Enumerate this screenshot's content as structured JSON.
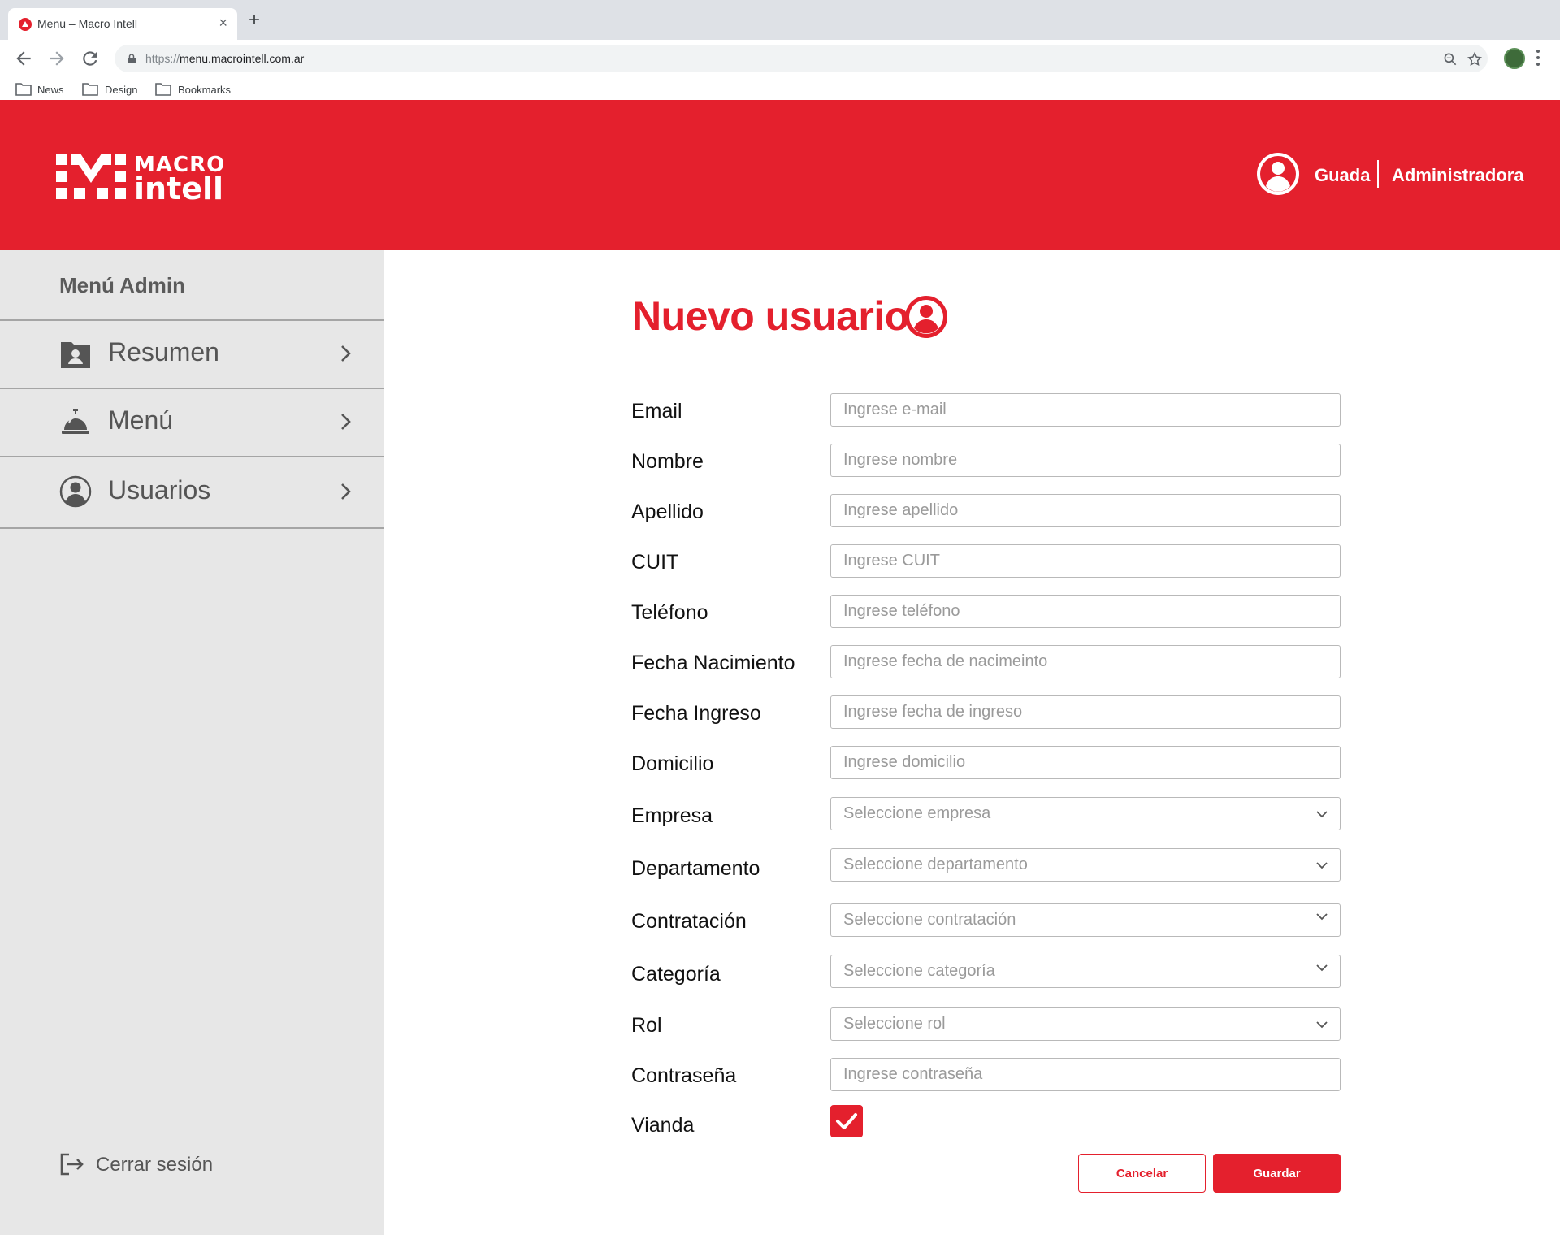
{
  "browser": {
    "tab_title": "Menu – Macro Intell",
    "url_scheme": "https://",
    "url_host": "menu.macrointell.com.ar",
    "bookmarks": [
      "News",
      "Design",
      "Bookmarks"
    ]
  },
  "header": {
    "logo_line1": "MACRO",
    "logo_line2": "intell",
    "user_name": "Guada",
    "user_role": "Administradora",
    "brand_color": "#e4202d"
  },
  "sidebar": {
    "title": "Menú Admin",
    "items": [
      {
        "label": "Resumen",
        "icon": "folder-user-icon"
      },
      {
        "label": "Menú",
        "icon": "service-bell-icon"
      },
      {
        "label": "Usuarios",
        "icon": "user-circle-icon"
      }
    ],
    "logout_label": "Cerrar sesión"
  },
  "form": {
    "title": "Nuevo usuario",
    "fields": [
      {
        "label": "Email",
        "placeholder": "Ingrese e-mail",
        "type": "text"
      },
      {
        "label": "Nombre",
        "placeholder": "Ingrese nombre",
        "type": "text"
      },
      {
        "label": "Apellido",
        "placeholder": "Ingrese apellido",
        "type": "text"
      },
      {
        "label": "CUIT",
        "placeholder": "Ingrese CUIT",
        "type": "text"
      },
      {
        "label": "Teléfono",
        "placeholder": "Ingrese teléfono",
        "type": "text"
      },
      {
        "label": "Fecha Nacimiento",
        "placeholder": "Ingrese fecha de nacimeinto",
        "type": "text"
      },
      {
        "label": "Fecha Ingreso",
        "placeholder": "Ingrese fecha de ingreso",
        "type": "text"
      },
      {
        "label": "Domicilio",
        "placeholder": "Ingrese domicilio",
        "type": "text"
      },
      {
        "label": "Empresa",
        "placeholder": "Seleccione empresa",
        "type": "select"
      },
      {
        "label": "Departamento",
        "placeholder": "Seleccione departamento",
        "type": "select"
      },
      {
        "label": "Contratación",
        "placeholder": "Seleccione contratación",
        "type": "select"
      },
      {
        "label": "Categoría",
        "placeholder": "Seleccione categoría",
        "type": "select"
      },
      {
        "label": "Rol",
        "placeholder": "Seleccione rol",
        "type": "select"
      },
      {
        "label": "Contraseña",
        "placeholder": "Ingrese contraseña",
        "type": "password"
      }
    ],
    "vianda_label": "Vianda",
    "vianda_checked": true,
    "cancel_label": "Cancelar",
    "save_label": "Guardar"
  }
}
